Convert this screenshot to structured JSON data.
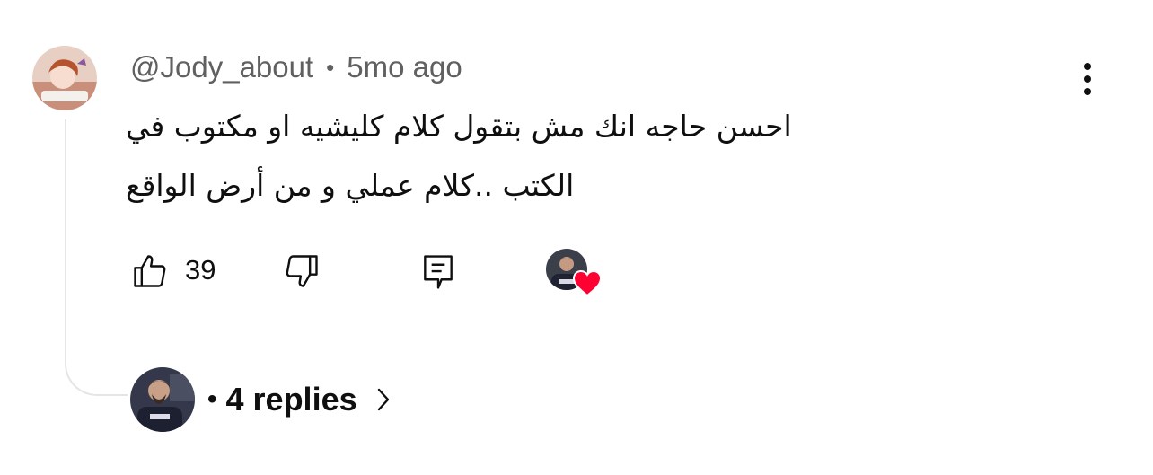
{
  "comment": {
    "author": "@Jody_about",
    "separator": "•",
    "time": "5mo ago",
    "text_lines": [
      "احسن حاجه انك مش بتقول كلام كليشيه او مكتوب في",
      "الكتب ..كلام عملي و من أرض الواقع"
    ],
    "like_count": "39",
    "icons": {
      "more": "more-vert-icon",
      "like": "thumb-up-icon",
      "dislike": "thumb-down-icon",
      "reply": "reply-icon",
      "heart": "heart-icon"
    },
    "colors": {
      "heart": "#ff0033",
      "meta": "#606060",
      "text": "#0f0f0f"
    }
  },
  "replies": {
    "separator": "•",
    "label": "4 replies",
    "icon": "chevron-right-icon"
  }
}
